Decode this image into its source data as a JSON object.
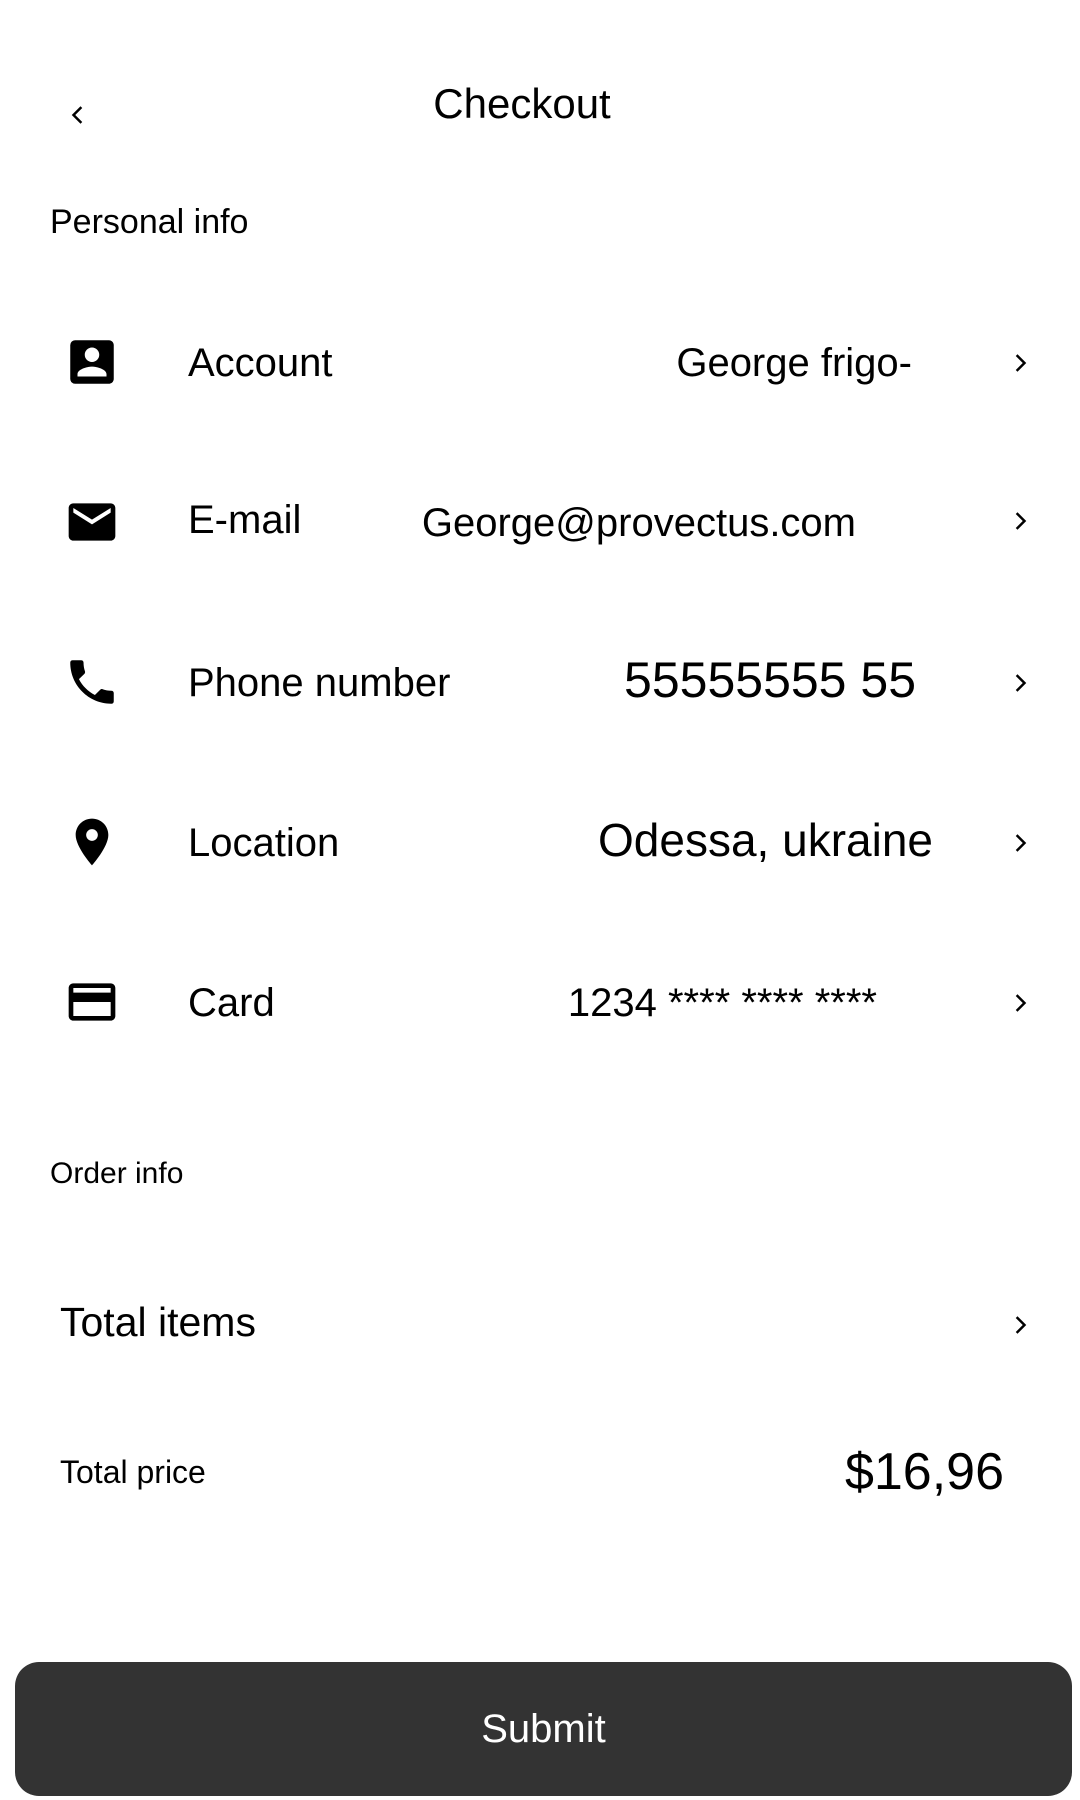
{
  "header": {
    "title": "Checkout",
    "back_icon": "chevron-left-icon"
  },
  "personal_info": {
    "section_title": "Personal info",
    "rows": [
      {
        "label": "Account",
        "value": "George frigo-",
        "icon": "account-box-icon"
      },
      {
        "label": "E-mail",
        "value": "George@provectus.com",
        "icon": "mail-icon"
      },
      {
        "label": "Phone number",
        "value": "55555555 55",
        "icon": "phone-icon"
      },
      {
        "label": "Location",
        "value": "Odessa, ukraine",
        "icon": "location-pin-icon"
      },
      {
        "label": "Card",
        "value": "1234 **** **** ****",
        "icon": "credit-card-icon"
      }
    ]
  },
  "order_info": {
    "section_title": "Order info",
    "total_items_label": "Total items",
    "total_price_label": "Total price",
    "total_price_value": "$16,96"
  },
  "submit": {
    "label": "Submit"
  },
  "colors": {
    "button_background": "#333333",
    "button_text": "#ffffff",
    "text": "#000000",
    "background": "#ffffff"
  }
}
